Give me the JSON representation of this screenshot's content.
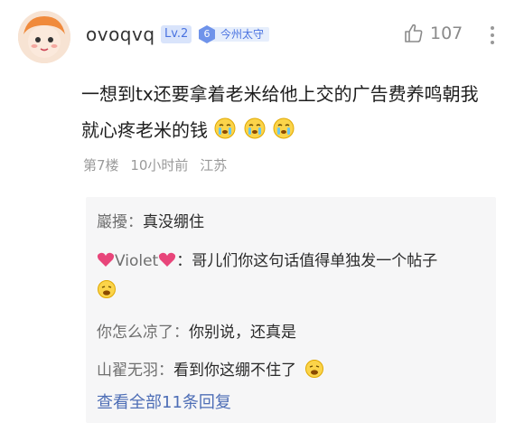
{
  "user": {
    "name": "ovoqvq",
    "level": "Lv.2",
    "rank_number": "6",
    "rank_title": "今州太守"
  },
  "like_count": "107",
  "comment": {
    "line1": "一想到tx还要拿着老米给他上交的广告费养鸣朝我",
    "line2": "就心疼老米的钱"
  },
  "meta": {
    "floor": "第7楼",
    "time": "10小时前",
    "location": "江苏"
  },
  "replies": [
    {
      "name": "巖擾：",
      "text": "真没绷住"
    },
    {
      "name": "Violet",
      "text": "：哥儿们你这句话值得单独发一个帖子"
    },
    {
      "name": "你怎么凉了：",
      "text": "你别说，还真是"
    },
    {
      "name": "山翟无羽：",
      "text": "看到你这绷不住了"
    }
  ],
  "view_all": "查看全部11条回复",
  "colors": {
    "accent": "#4a73e0",
    "link": "#4e6eb6",
    "heart": "#e8457a"
  }
}
